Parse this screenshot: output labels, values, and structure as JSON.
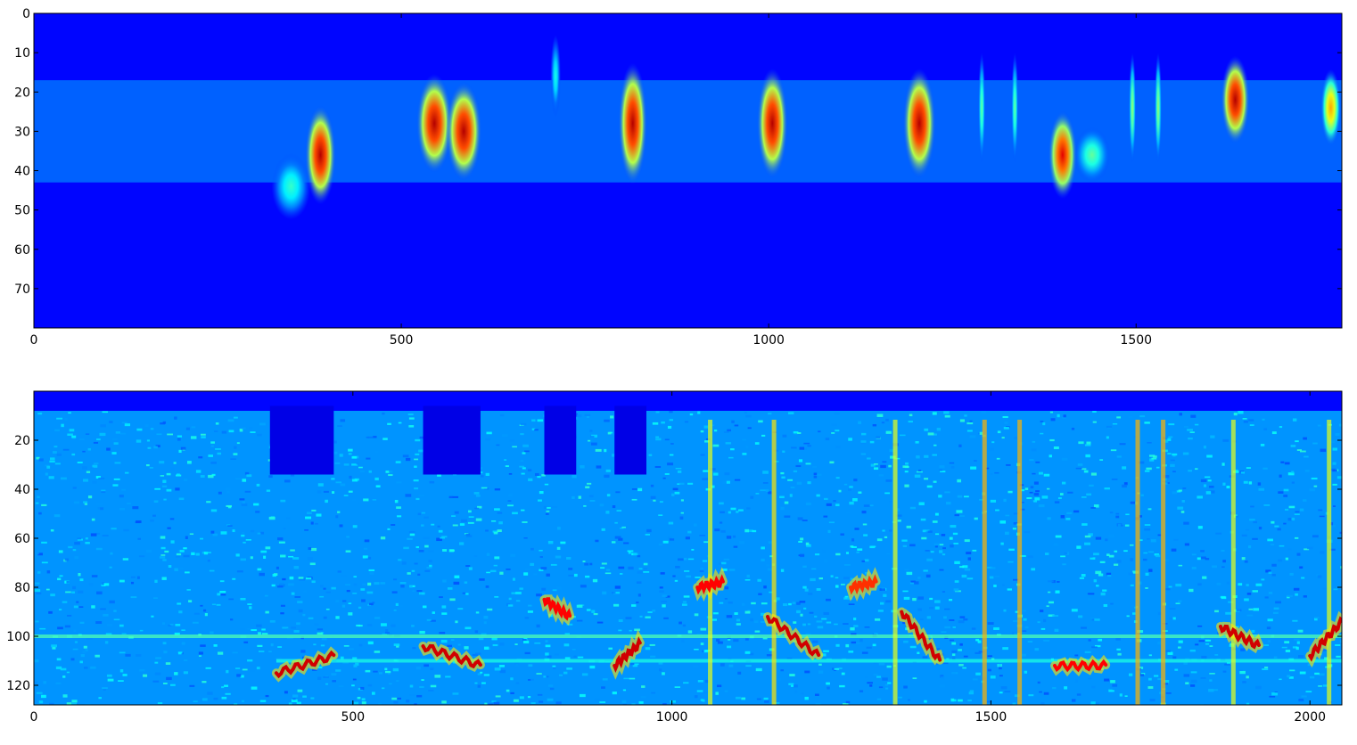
{
  "chart_data": [
    {
      "type": "heatmap",
      "title": "",
      "xlabel": "",
      "ylabel": "",
      "xlim": [
        0,
        1780
      ],
      "ylim": [
        80,
        0
      ],
      "xticks": [
        0,
        500,
        1000,
        1500
      ],
      "yticks": [
        0,
        10,
        20,
        30,
        40,
        50,
        60,
        70
      ],
      "colormap": "jet",
      "background_band": {
        "y_range": [
          17,
          43
        ]
      },
      "blobs": [
        {
          "x": 390,
          "y": 36,
          "w": 30,
          "h": 18,
          "intensity": 1.0
        },
        {
          "x": 350,
          "y": 44,
          "w": 38,
          "h": 12,
          "intensity": 0.45
        },
        {
          "x": 545,
          "y": 28,
          "w": 35,
          "h": 18,
          "intensity": 1.0
        },
        {
          "x": 585,
          "y": 30,
          "w": 35,
          "h": 18,
          "intensity": 1.0
        },
        {
          "x": 710,
          "y": 16,
          "w": 10,
          "h": 15,
          "intensity": 0.42
        },
        {
          "x": 815,
          "y": 28,
          "w": 28,
          "h": 22,
          "intensity": 1.0
        },
        {
          "x": 1005,
          "y": 28,
          "w": 30,
          "h": 20,
          "intensity": 1.0
        },
        {
          "x": 1205,
          "y": 28,
          "w": 32,
          "h": 20,
          "intensity": 1.0
        },
        {
          "x": 1290,
          "y": 24,
          "w": 7,
          "h": 20,
          "intensity": 0.5
        },
        {
          "x": 1335,
          "y": 24,
          "w": 7,
          "h": 20,
          "intensity": 0.5
        },
        {
          "x": 1400,
          "y": 36,
          "w": 28,
          "h": 16,
          "intensity": 0.95
        },
        {
          "x": 1440,
          "y": 36,
          "w": 35,
          "h": 10,
          "intensity": 0.5
        },
        {
          "x": 1495,
          "y": 24,
          "w": 7,
          "h": 20,
          "intensity": 0.55
        },
        {
          "x": 1530,
          "y": 24,
          "w": 7,
          "h": 20,
          "intensity": 0.55
        },
        {
          "x": 1635,
          "y": 22,
          "w": 28,
          "h": 16,
          "intensity": 1.0
        },
        {
          "x": 1765,
          "y": 24,
          "w": 20,
          "h": 14,
          "intensity": 0.75
        }
      ]
    },
    {
      "type": "heatmap",
      "title": "",
      "xlabel": "",
      "ylabel": "",
      "xlim": [
        0,
        2050
      ],
      "ylim": [
        128,
        0
      ],
      "xticks": [
        0,
        500,
        1000,
        1500,
        2000
      ],
      "yticks": [
        20,
        40,
        60,
        80,
        100,
        120
      ],
      "colormap": "jet",
      "noise_band": {
        "y_range": [
          8,
          128
        ]
      },
      "horizontal_lines": [
        {
          "y": 100,
          "x_range": [
            0,
            2050
          ],
          "intensity": 0.45
        },
        {
          "y": 110,
          "x_range": [
            380,
            2050
          ],
          "intensity": 0.4
        }
      ],
      "dark_gaps": [
        {
          "x_range": [
            370,
            470
          ],
          "y_range": [
            6,
            34
          ]
        },
        {
          "x_range": [
            610,
            700
          ],
          "y_range": [
            6,
            34
          ]
        },
        {
          "x_range": [
            800,
            850
          ],
          "y_range": [
            6,
            34
          ]
        },
        {
          "x_range": [
            910,
            960
          ],
          "y_range": [
            6,
            34
          ]
        }
      ],
      "tonal_traces": [
        {
          "x_range": [
            380,
            470
          ],
          "y_range": [
            115,
            108
          ],
          "intensity": 1.0
        },
        {
          "x_range": [
            610,
            700
          ],
          "y_range": [
            104,
            112
          ],
          "intensity": 1.0
        },
        {
          "x_range": [
            800,
            840
          ],
          "y_range": [
            85,
            92
          ],
          "intensity": 0.95
        },
        {
          "x_range": [
            910,
            950
          ],
          "y_range": [
            112,
            103
          ],
          "intensity": 1.0
        },
        {
          "x_range": [
            1040,
            1080
          ],
          "y_range": [
            80,
            78
          ],
          "intensity": 0.95
        },
        {
          "x_range": [
            1150,
            1230
          ],
          "y_range": [
            92,
            108
          ],
          "intensity": 1.0
        },
        {
          "x_range": [
            1280,
            1320
          ],
          "y_range": [
            80,
            78
          ],
          "intensity": 0.9
        },
        {
          "x_range": [
            1360,
            1420
          ],
          "y_range": [
            90,
            110
          ],
          "intensity": 1.0
        },
        {
          "x_range": [
            1600,
            1680
          ],
          "y_range": [
            112,
            112
          ],
          "intensity": 0.95
        },
        {
          "x_range": [
            1860,
            1920
          ],
          "y_range": [
            96,
            104
          ],
          "intensity": 1.0
        },
        {
          "x_range": [
            2000,
            2050
          ],
          "y_range": [
            108,
            94
          ],
          "intensity": 1.0
        }
      ],
      "vertical_streaks": [
        {
          "x": 1060,
          "intensity": 0.6
        },
        {
          "x": 1160,
          "intensity": 0.65
        },
        {
          "x": 1350,
          "intensity": 0.6
        },
        {
          "x": 1490,
          "intensity": 0.7
        },
        {
          "x": 1545,
          "intensity": 0.7
        },
        {
          "x": 1730,
          "intensity": 0.7
        },
        {
          "x": 1770,
          "intensity": 0.7
        },
        {
          "x": 1880,
          "intensity": 0.6
        },
        {
          "x": 2030,
          "intensity": 0.6
        }
      ]
    }
  ]
}
